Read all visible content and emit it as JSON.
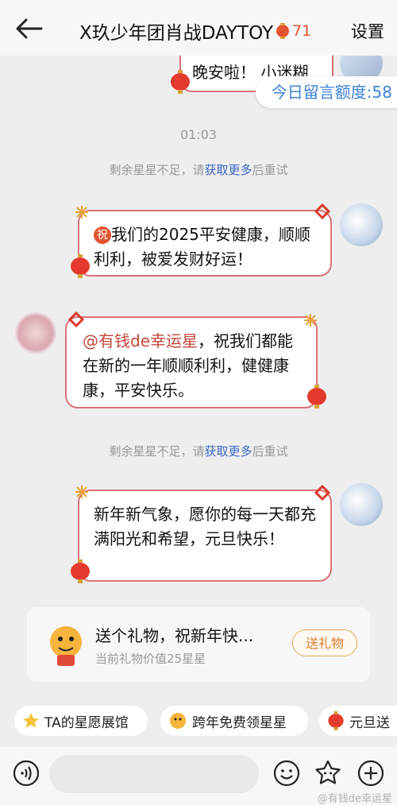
{
  "header": {
    "title": "X玖少年团肖战DAYTOY",
    "count": "71",
    "settings": "设置"
  },
  "top_partial_message": "晚安啦！ 小迷糊",
  "quota": "今日留言额度:58",
  "time": "01:03",
  "system_notice": {
    "prefix": "剩余星星不足，请",
    "link": "获取更多",
    "suffix": "后重试"
  },
  "messages": [
    {
      "side": "right",
      "badge": "祝",
      "text": "我们的2025平安健康，顺顺利利，被爱发财好运！"
    },
    {
      "side": "left",
      "mention": "@有钱de幸运星",
      "text": "，祝我们都能在新的一年顺顺利利，健健康康，平安快乐。"
    },
    {
      "side": "right",
      "text": "新年新气象，愿你的每一天都充满阳光和希望，元旦快乐！"
    }
  ],
  "gift": {
    "title": "送个礼物，祝新年快...",
    "subtitle": "当前礼物价值25星星",
    "button": "送礼物"
  },
  "chips": [
    {
      "label": "TA的星愿展馆",
      "icon": "star-icon"
    },
    {
      "label": "跨年免费领星星",
      "icon": "tiger-icon"
    },
    {
      "label": "元旦送",
      "icon": "lantern-icon"
    }
  ],
  "watermark": "@有钱de幸运星",
  "colors": {
    "accent_red": "#e4532f",
    "bubble_border": "#d9727a",
    "link_blue": "#3a67c2",
    "quota_blue": "#3b82d6",
    "gift_orange": "#e0792d"
  }
}
